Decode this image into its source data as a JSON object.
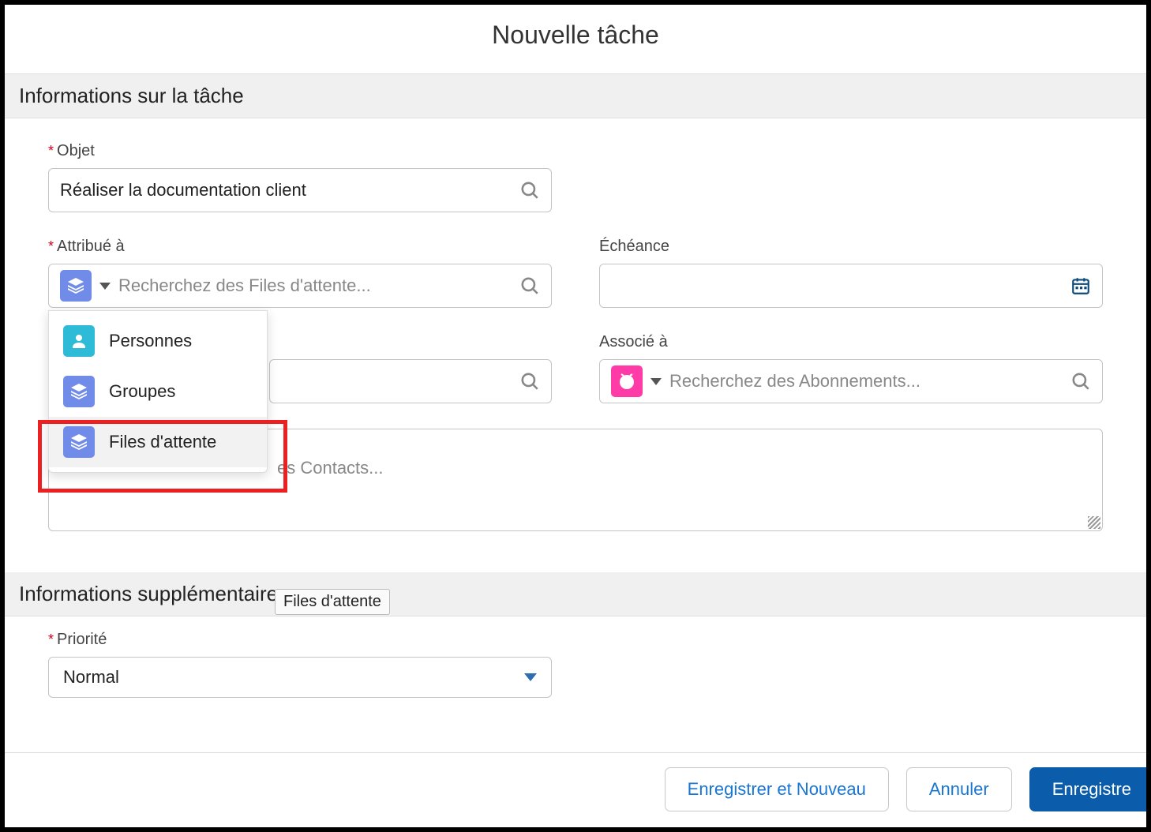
{
  "modal": {
    "title": "Nouvelle tâche"
  },
  "sections": {
    "task_info": "Informations sur la tâche",
    "extra_info": "Informations supplémentaires"
  },
  "fields": {
    "subject": {
      "label": "Objet",
      "value": "Réaliser la documentation client"
    },
    "assigned": {
      "label": "Attribué à",
      "placeholder": "Recherchez des Files d'attente..."
    },
    "due_date": {
      "label": "Échéance"
    },
    "contacts": {
      "placeholder_fragment": "es Contacts..."
    },
    "related": {
      "label": "Associé à",
      "placeholder": "Recherchez des Abonnements..."
    },
    "priority": {
      "label": "Priorité",
      "value": "Normal"
    }
  },
  "dropdown": {
    "items": [
      {
        "label": "Personnes",
        "icon": "person"
      },
      {
        "label": "Groupes",
        "icon": "stack"
      },
      {
        "label": "Files d'attente",
        "icon": "stack"
      }
    ]
  },
  "tooltip": {
    "queues": "Files d'attente"
  },
  "buttons": {
    "save_new": "Enregistrer et Nouveau",
    "cancel": "Annuler",
    "save": "Enregistre"
  }
}
